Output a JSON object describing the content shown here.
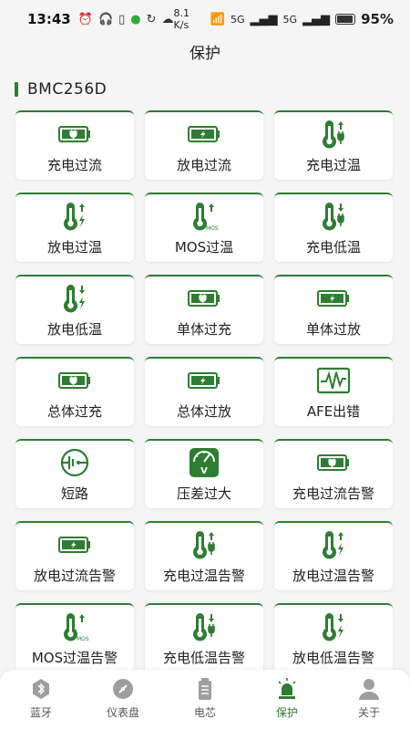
{
  "status_bar": {
    "time": "13:43",
    "speed": "8.1 K/s",
    "signal_1": "5G",
    "signal_2": "5G",
    "battery": "95%"
  },
  "header": {
    "title": "保护"
  },
  "device": {
    "name": "BMC256D"
  },
  "colors": {
    "accent": "#2e7d32",
    "inactive": "#9e9e9e"
  },
  "protections": [
    {
      "label": "充电过流",
      "icon": "battery-charge-icon"
    },
    {
      "label": "放电过流",
      "icon": "battery-discharge-icon"
    },
    {
      "label": "充电过温",
      "icon": "thermometer-charge-up-icon"
    },
    {
      "label": "放电过温",
      "icon": "thermometer-discharge-up-icon"
    },
    {
      "label": "MOS过温",
      "icon": "thermometer-mos-icon"
    },
    {
      "label": "充电低温",
      "icon": "thermometer-charge-down-icon"
    },
    {
      "label": "放电低温",
      "icon": "thermometer-discharge-down-icon"
    },
    {
      "label": "单体过充",
      "icon": "battery-charge-icon"
    },
    {
      "label": "单体过放",
      "icon": "battery-discharge-icon"
    },
    {
      "label": "总体过充",
      "icon": "battery-charge-icon"
    },
    {
      "label": "总体过放",
      "icon": "battery-discharge-icon"
    },
    {
      "label": "AFE出错",
      "icon": "waveform-icon"
    },
    {
      "label": "短路",
      "icon": "short-circuit-icon"
    },
    {
      "label": "压差过大",
      "icon": "voltmeter-icon"
    },
    {
      "label": "充电过流告警",
      "icon": "battery-charge-icon"
    },
    {
      "label": "放电过流告警",
      "icon": "battery-discharge-icon"
    },
    {
      "label": "充电过温告警",
      "icon": "thermometer-charge-up-icon"
    },
    {
      "label": "放电过温告警",
      "icon": "thermometer-discharge-up-icon"
    },
    {
      "label": "MOS过温告警",
      "icon": "thermometer-mos-icon"
    },
    {
      "label": "充电低温告警",
      "icon": "thermometer-charge-down-icon"
    },
    {
      "label": "放电低温告警",
      "icon": "thermometer-discharge-down-icon"
    }
  ],
  "nav": [
    {
      "label": "蓝牙",
      "icon": "bluetooth-icon",
      "active": false
    },
    {
      "label": "仪表盘",
      "icon": "dashboard-icon",
      "active": false
    },
    {
      "label": "电芯",
      "icon": "cell-icon",
      "active": false
    },
    {
      "label": "保护",
      "icon": "alarm-light-icon",
      "active": true
    },
    {
      "label": "关于",
      "icon": "person-icon",
      "active": false
    }
  ]
}
